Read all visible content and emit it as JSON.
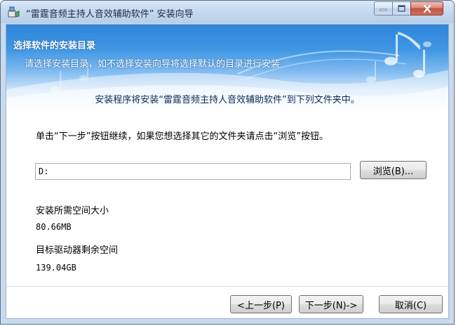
{
  "window": {
    "title": "“雷霆音频主持人音效辅助软件” 安装向导"
  },
  "banner": {
    "title": "选择软件的安装目录",
    "subtitle": "请选择安装目录，如不选择安装向导将选择默认的目录进行安装",
    "message": "安装程序将安装“雷霆音频主持人音效辅助软件”到下列文件夹中。"
  },
  "body": {
    "instruction": "单击“下一步”按钮继续，如果您想选择其它的文件夹请点击“浏览”按钮。",
    "path_value": "D:",
    "browse_label": "浏览(B)...",
    "space_required_label": "安装所需空间大小",
    "space_required_value": "80.66MB",
    "space_available_label": "目标驱动器剩余空间",
    "space_available_value": "139.04GB"
  },
  "footer": {
    "back_label": "<上一步(P)",
    "next_label": "下一步(N)->",
    "cancel_label": "取消(C)"
  },
  "colors": {
    "banner_blue": "#3f97e4",
    "close_red": "#c4513f"
  }
}
